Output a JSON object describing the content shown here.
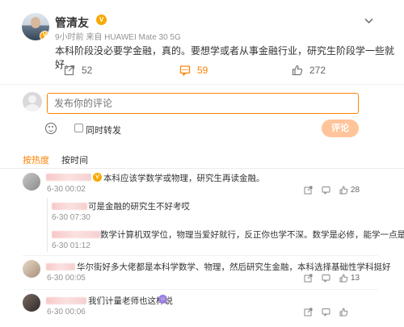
{
  "post": {
    "author": "管清友",
    "author_badge": "V",
    "meta": "9小时前 来自 HUAWEI Mate 30 5G",
    "text": "本科阶段没必要学金融，真的。要想学或者从事金融行业，研究生阶段学一些就好。",
    "actions": {
      "repost_count": "52",
      "comment_count": "59",
      "like_count": "272"
    }
  },
  "composer": {
    "placeholder": "发布你的评论",
    "repost_label": "同时转发",
    "submit_label": "评论"
  },
  "sort": {
    "hot_label": "按热度",
    "time_label": "按时间"
  },
  "comments": [
    {
      "text": "本科应该学数学或物理，研究生再读金融。",
      "time": "6-30 00:02",
      "likes": "28",
      "replies": [
        {
          "text": "可是金融的研究生不好考哎",
          "time": "6-30 07:30"
        },
        {
          "text": "数学计算机双学位，物理当爱好就行，反正你也学不深。数学是必修，能学一点是一点",
          "time": "6-30 01:12"
        }
      ]
    },
    {
      "text": "华尔街好多大佬都是本科学数学、物理，然后研究生金融，本科选择基础性学科挺好",
      "time": "6-30 00:05",
      "likes": "13"
    },
    {
      "text": "我们计量老师也这样说",
      "time": "6-30 00:06",
      "likes": ""
    }
  ],
  "colors": {
    "accent": "#ff8200",
    "submit_disabled": "#ffc49a",
    "badge": "#f7a800"
  },
  "icons": [
    "chevron-down-icon",
    "repost-icon",
    "comment-icon",
    "like-icon",
    "emoji-icon",
    "share-icon",
    "reply-icon"
  ]
}
